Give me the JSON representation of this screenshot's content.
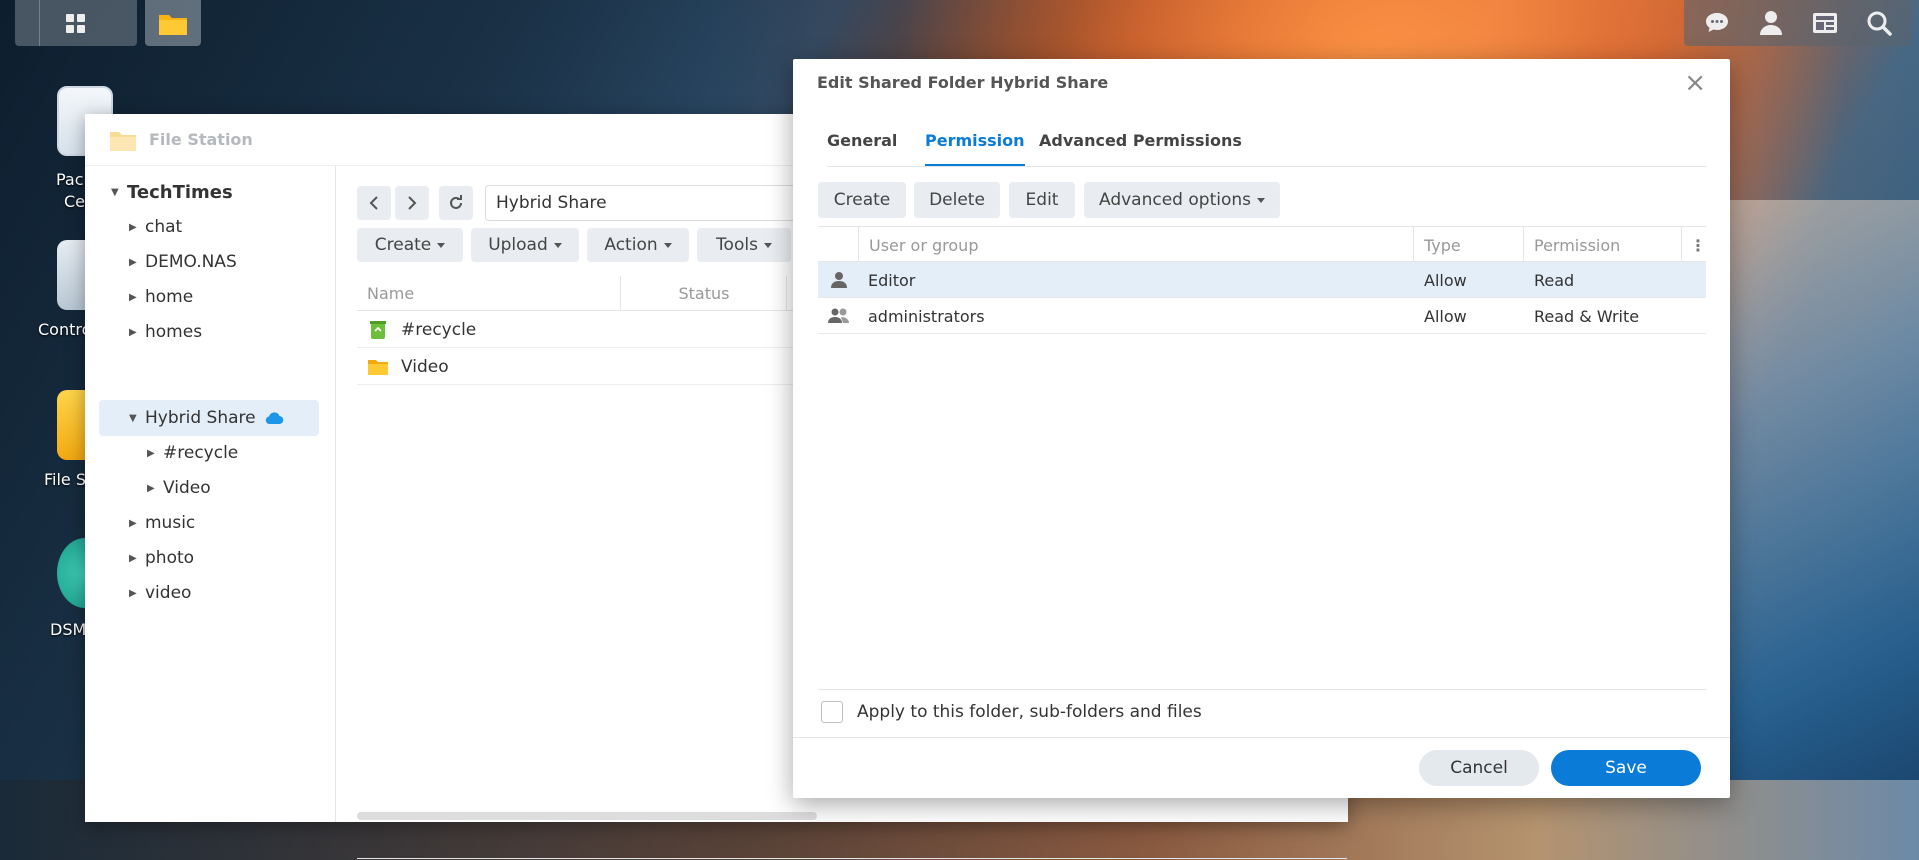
{
  "desktop": {
    "icons": [
      {
        "label": "Package Center",
        "visible_label_1": "Pack",
        "visible_label_2": "Cen"
      },
      {
        "label": "Control Panel",
        "visible_label": "Contro"
      },
      {
        "label": "File Station",
        "visible_label": "File S"
      },
      {
        "label": "DSM Help",
        "visible_label": "DSM"
      }
    ]
  },
  "file_station": {
    "title": "File Station",
    "tree": {
      "root": "TechTimes",
      "items": [
        "chat",
        "DEMO.NAS",
        "home",
        "homes",
        "Hybrid Share",
        "#recycle",
        "Video",
        "music",
        "photo",
        "video"
      ]
    },
    "path": "Hybrid Share",
    "toolbar": {
      "create": "Create",
      "upload": "Upload",
      "action": "Action",
      "tools": "Tools"
    },
    "columns": {
      "name": "Name",
      "status": "Status"
    },
    "files": [
      {
        "name": "#recycle",
        "icon": "recycle-bin-icon"
      },
      {
        "name": "Video",
        "icon": "folder-icon"
      }
    ]
  },
  "dialog": {
    "title": "Edit Shared Folder Hybrid Share",
    "tabs": {
      "general": "General",
      "permission": "Permission",
      "advanced": "Advanced Permissions"
    },
    "active_tab": "Permission",
    "buttons": {
      "create": "Create",
      "delete": "Delete",
      "edit": "Edit",
      "advanced_options": "Advanced options"
    },
    "columns": {
      "user": "User or group",
      "type": "Type",
      "permission": "Permission"
    },
    "rows": [
      {
        "name": "Editor",
        "kind": "user",
        "type": "Allow",
        "permission": "Read",
        "selected": true
      },
      {
        "name": "administrators",
        "kind": "group",
        "type": "Allow",
        "permission": "Read & Write",
        "selected": false
      }
    ],
    "apply_label": "Apply to this folder, sub-folders and files",
    "apply_checked": false,
    "cancel": "Cancel",
    "save": "Save",
    "accent_color": "#0a7bd6"
  }
}
